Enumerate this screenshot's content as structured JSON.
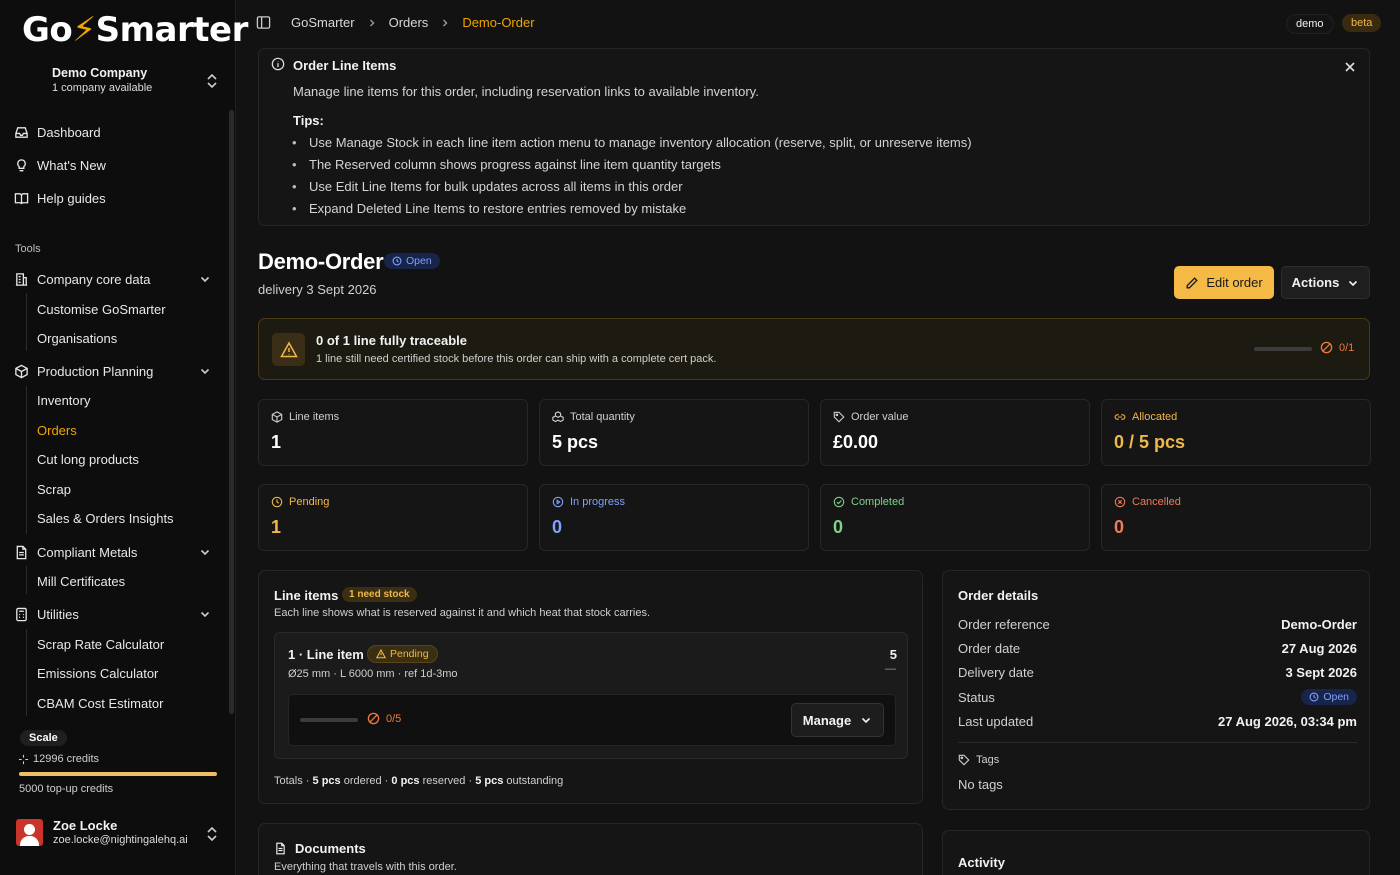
{
  "brand": {
    "logo_left": "Go",
    "logo_bolt": "⚡",
    "logo_right": "Smarter"
  },
  "company": {
    "name": "Demo Company",
    "sub": "1 company available"
  },
  "sidebar": {
    "top_items": [
      {
        "label": "Dashboard",
        "icon": "inbox-icon"
      },
      {
        "label": "What's New",
        "icon": "lightbulb-icon"
      },
      {
        "label": "Help guides",
        "icon": "book-icon"
      }
    ],
    "section_label": "Tools",
    "groups": [
      {
        "label": "Company core data",
        "children": [
          "Customise GoSmarter",
          "Organisations"
        ]
      },
      {
        "label": "Production Planning",
        "children": [
          "Inventory",
          "Orders",
          "Cut long products",
          "Scrap",
          "Sales & Orders Insights"
        ]
      },
      {
        "label": "Compliant Metals",
        "children": [
          "Mill Certificates"
        ]
      },
      {
        "label": "Utilities",
        "children": [
          "Scrap Rate Calculator",
          "Emissions Calculator",
          "CBAM Cost Estimator"
        ]
      }
    ],
    "active_item": "Orders",
    "plan": "Scale",
    "credits": "12996 credits",
    "credits_fraction": 1.0,
    "topup": "5000 top-up credits",
    "user": {
      "name": "Zoe Locke",
      "email": "zoe.locke@nightingalehq.ai"
    }
  },
  "breadcrumb": [
    "GoSmarter",
    "Orders",
    "Demo-Order"
  ],
  "env": {
    "demo": "demo",
    "beta": "beta"
  },
  "info": {
    "title": "Order Line Items",
    "desc": "Manage line items for this order, including reservation links to available inventory.",
    "tips_label": "Tips:",
    "tips": [
      "Use Manage Stock in each line item action menu to manage inventory allocation (reserve, split, or unreserve items)",
      "The Reserved column shows progress against line item quantity targets",
      "Use Edit Line Items for bulk updates across all items in this order",
      "Expand Deleted Line Items to restore entries removed by mistake"
    ]
  },
  "order": {
    "title": "Demo-Order",
    "status": "Open",
    "subtitle": "delivery 3 Sept 2026",
    "edit_label": "Edit order",
    "actions_label": "Actions"
  },
  "trace": {
    "title": "0 of 1 line fully traceable",
    "desc": "1 line still need certified stock before this order can ship with a complete cert pack.",
    "count": "0/1",
    "fraction": 0
  },
  "stats": [
    {
      "label": "Line items",
      "value": "1",
      "icon": "box-icon",
      "color": "#cfcfcf",
      "value_color": "#ffffff"
    },
    {
      "label": "Total quantity",
      "value": "5 pcs",
      "icon": "boxes-icon",
      "color": "#cfcfcf",
      "value_color": "#ffffff"
    },
    {
      "label": "Order value",
      "value": "£0.00",
      "icon": "tag-icon",
      "color": "#cfcfcf",
      "value_color": "#ffffff"
    },
    {
      "label": "Allocated",
      "value": "0 / 5 pcs",
      "icon": "link-icon",
      "color": "#f0b84a",
      "value_color": "#f0b84a"
    },
    {
      "label": "Pending",
      "value": "1",
      "icon": "clock-icon",
      "color": "#f0b84a",
      "value_color": "#f0b84a"
    },
    {
      "label": "In progress",
      "value": "0",
      "icon": "play-circle-icon",
      "color": "#7fa2ff",
      "value_color": "#7fa2ff"
    },
    {
      "label": "Completed",
      "value": "0",
      "icon": "check-circle-icon",
      "color": "#7fd18a",
      "value_color": "#7fd18a"
    },
    {
      "label": "Cancelled",
      "value": "0",
      "icon": "x-circle-icon",
      "color": "#f07a5a",
      "value_color": "#f07a5a"
    }
  ],
  "line_items": {
    "title": "Line items",
    "badge": "1 need stock",
    "desc": "Each line shows what is reserved against it and which heat that stock carries.",
    "item": {
      "title": "1 · Line item",
      "status": "Pending",
      "meta": "Ø25 mm · L 6000 mm · ref 1d-3mo",
      "qty": "5",
      "dash": "—",
      "reserved": "0/5",
      "reserved_fraction": 0,
      "manage_label": "Manage"
    },
    "totals": {
      "prefix": "Totals · ",
      "ordered_val": "5 pcs",
      "ordered_txt": " ordered · ",
      "reserved_val": "0 pcs",
      "reserved_txt": " reserved · ",
      "outstanding_val": "5 pcs",
      "outstanding_txt": " outstanding"
    }
  },
  "order_details": {
    "title": "Order details",
    "rows": [
      {
        "k": "Order reference",
        "v": "Demo-Order"
      },
      {
        "k": "Order date",
        "v": "27 Aug 2026"
      },
      {
        "k": "Delivery date",
        "v": "3 Sept 2026"
      },
      {
        "k": "Status",
        "v": "Open"
      },
      {
        "k": "Last updated",
        "v": "27 Aug 2026, 03:34 pm"
      }
    ],
    "tags_label": "Tags",
    "no_tags": "No tags"
  },
  "documents": {
    "title": "Documents",
    "desc": "Everything that travels with this order."
  },
  "activity": {
    "title": "Activity"
  }
}
